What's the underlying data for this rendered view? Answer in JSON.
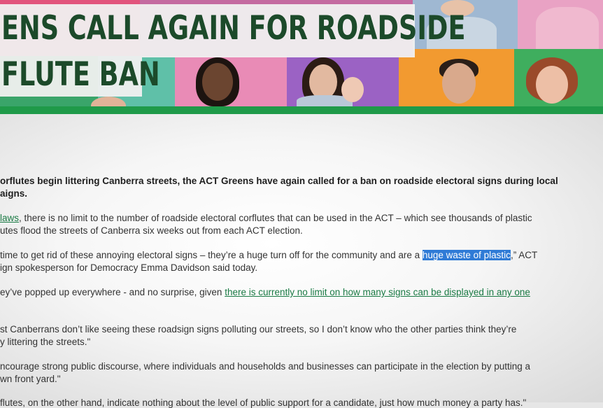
{
  "banner": {
    "headline_line1": "ENS CALL AGAIN FOR ROADSIDE",
    "headline_line2": "FLUTE BAN",
    "colors": {
      "green": "#1f9a49",
      "pink": "#e87ab0",
      "orange": "#f29a2e",
      "purple": "#9a5fc0",
      "teal": "#3db0a0"
    }
  },
  "article": {
    "lead": [
      "orflutes begin littering Canberra streets, the ACT Greens have again called for a ban on roadside electoral signs during local",
      "aigns."
    ],
    "p1": {
      "link": "laws",
      "rest1": ", there is no limit to the number of roadside electoral corflutes that can be used in the ACT – which see thousands of plastic",
      "line2": "utes flood the streets of Canberra six weeks out from each ACT election."
    },
    "p2": {
      "before": "time to get rid of these annoying electoral signs – they’re a huge turn off for the community and are a ",
      "highlight": "huge waste of plastic",
      "after": ",” ACT",
      "line2": "ign spokesperson for Democracy Emma Davidson said today."
    },
    "p3": {
      "before": "ey’ve popped up everywhere - and no surprise, given ",
      "link": "there is currently no limit on how many signs can be displayed in any one"
    },
    "p4": {
      "line1": "st Canberrans don’t like  seeing these roadsign signs polluting our streets, so I don’t know who the other parties think they’re",
      "line2": "y littering the streets.\""
    },
    "p5": {
      "line1": "ncourage strong public discourse, where individuals and households and businesses can participate in the election by putting a",
      "line2": "wn front yard.\""
    },
    "p6": {
      "line1": "flutes, on the other hand, indicate nothing about the level of public support for a candidate, just how much money a party has.\""
    }
  }
}
